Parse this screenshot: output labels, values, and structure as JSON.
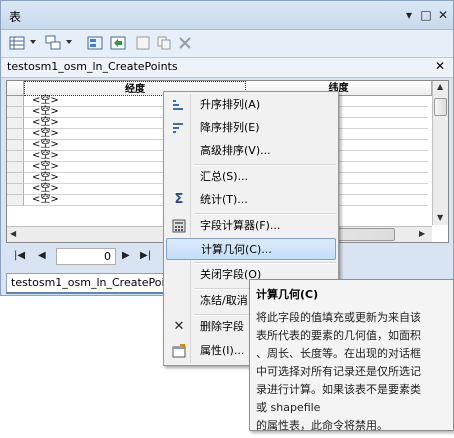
{
  "window": {
    "title": "表",
    "btn_dropdown": "▾",
    "btn_restore": "□",
    "btn_close": "✕"
  },
  "toolbar": {
    "icons": [
      "table-options-icon",
      "related-tables-icon",
      "select-by-attributes-icon",
      "switch-selection-icon",
      "clear-selection-icon",
      "delete-selected-icon"
    ]
  },
  "table_tab": {
    "title": "testosm1_osm_ln_CreatePoints",
    "close": "✕"
  },
  "grid": {
    "columns": [
      "经度",
      "纬度"
    ],
    "null_value": "<空>",
    "rows": [
      "<空>",
      "<空>",
      "<空>",
      "<空>",
      "<空>",
      "<空>",
      "<空>",
      "<空>",
      "<空>",
      "<空>"
    ]
  },
  "navigator": {
    "first": "|◀",
    "prev": "◀",
    "record": "0",
    "next": "▶",
    "last": "▶|"
  },
  "bottom_tab": {
    "label": "testosm1_osm_ln_CreatePoi"
  },
  "context_menu": {
    "items": [
      {
        "label": "升序排列(A)",
        "icon": "sort-ascending-icon"
      },
      {
        "label": "降序排列(E)",
        "icon": "sort-descending-icon"
      },
      {
        "label": "高级排序(V)...",
        "icon": ""
      },
      {
        "label": "汇总(S)...",
        "icon": ""
      },
      {
        "label": "统计(T)...",
        "icon": "sigma-icon"
      },
      {
        "label": "字段计算器(F)...",
        "icon": "field-calculator-icon"
      },
      {
        "label": "计算几何(C)...",
        "icon": ""
      },
      {
        "label": "关闭字段(O)",
        "icon": ""
      },
      {
        "label": "冻结/取消",
        "icon": ""
      },
      {
        "label": "删除字段",
        "icon": "delete-icon"
      },
      {
        "label": "属性(I)...",
        "icon": "properties-icon"
      }
    ]
  },
  "tooltip": {
    "title": "计算几何(C)",
    "lines": [
      "将此字段的值填充或更新为来自该",
      "表所代表的要素的几何值，如面积",
      "、周长、长度等。在出现的对话框",
      "中可选择对所有记录还是仅所选记",
      "录进行计算。如果该表不是要素类",
      "或 shapefile",
      "的属性表，此命令将禁用。"
    ]
  },
  "colors": {
    "highlight": "#c4ddf7",
    "window_bg": "#d8e4f1",
    "tab_underline": "#5b86b8"
  }
}
